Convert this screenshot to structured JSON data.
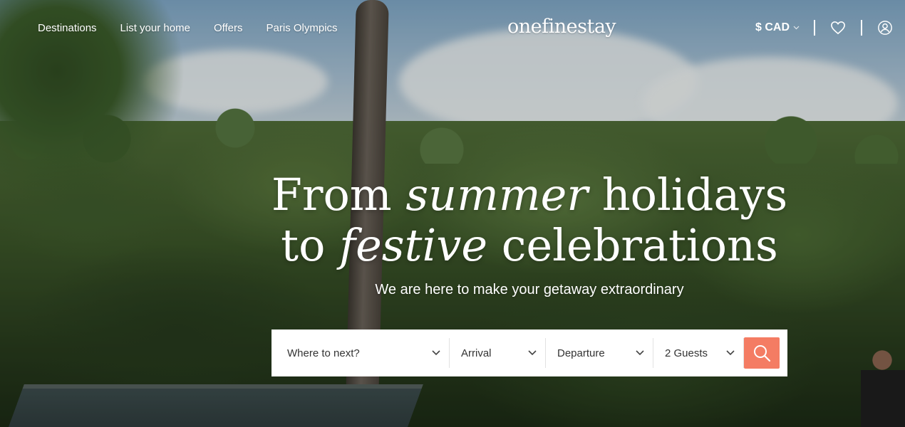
{
  "header": {
    "nav": [
      "Destinations",
      "List your home",
      "Offers",
      "Paris Olympics"
    ],
    "logo": "onefinestay",
    "currency": "$ CAD",
    "icons": [
      "chevron-down-icon",
      "heart-icon",
      "user-icon"
    ]
  },
  "hero": {
    "title_line1_part1": "From ",
    "title_line1_em": "summer",
    "title_line1_part2": " holidays",
    "title_line2_part1": "to ",
    "title_line2_em": "festive",
    "title_line2_part2": " celebrations",
    "subtitle": "We are here to make your getaway extraordinary"
  },
  "search": {
    "destination": "Where to next?",
    "arrival": "Arrival",
    "departure": "Departure",
    "guests": "2 Guests",
    "button_icon": "search-icon"
  },
  "colors": {
    "accent": "#f47c63",
    "search_bg": "#ffffff",
    "text_on_hero": "#ffffff"
  }
}
